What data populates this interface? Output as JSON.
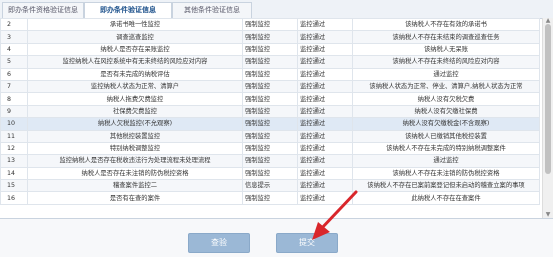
{
  "tabs": [
    {
      "label": "即办条件资格验证信息"
    },
    {
      "label": "即办条件验证信息"
    },
    {
      "label": "其他条件验证信息"
    }
  ],
  "table": {
    "rows": [
      {
        "no": "2",
        "item": "承诺书唯一性监控",
        "type": "强制监控",
        "result": "监控通过",
        "desc": "该纳税人不存在有效的承诺书"
      },
      {
        "no": "3",
        "item": "调查巡查监控",
        "type": "强制监控",
        "result": "监控通过",
        "desc": "该纳税人不存在未结束的调查巡查任务"
      },
      {
        "no": "4",
        "item": "纳税人是否存在呆账监控",
        "type": "强制监控",
        "result": "监控通过",
        "desc": "该纳税人无呆账"
      },
      {
        "no": "5",
        "item": "监控纳税人在风控系统中有无未终结的风险应对内容",
        "type": "强制监控",
        "result": "监控通过",
        "desc": "该纳税人不存在未终结的风险应对内容"
      },
      {
        "no": "6",
        "item": "是否有未完成的纳税评估",
        "type": "强制监控",
        "result": "监控通过",
        "desc": "通过监控"
      },
      {
        "no": "7",
        "item": "监控纳税人状态为正常、清算户",
        "type": "强制监控",
        "result": "监控通过",
        "desc": "该纳税人状态为正常、停业、清算户,纳税人状态为正常"
      },
      {
        "no": "8",
        "item": "纳税人拖费欠费监控",
        "type": "强制监控",
        "result": "监控通过",
        "desc": "纳税人没有欠税欠费"
      },
      {
        "no": "9",
        "item": "社保费欠费监控",
        "type": "强制监控",
        "result": "监控通过",
        "desc": "纳税人没有欠缴社保费"
      },
      {
        "no": "10",
        "item": "纳税人欠税监控(不允观察)",
        "type": "强制监控",
        "result": "监控通过",
        "desc": "纳税人没有欠缴税金(不含观察)"
      },
      {
        "no": "11",
        "item": "其他税控装置监控",
        "type": "强制监控",
        "result": "监控通过",
        "desc": "该纳税人已缴销其他税控装置"
      },
      {
        "no": "12",
        "item": "特别纳税调整监控",
        "type": "强制监控",
        "result": "监控通过",
        "desc": "该纳税人不存在未完成的特别纳税调整案件"
      },
      {
        "no": "13",
        "item": "监控纳税人是否存在税收违法行为处理流程未处理流程",
        "type": "强制监控",
        "result": "监控通过",
        "desc": "通过监控"
      },
      {
        "no": "14",
        "item": "纳税人是否存在未注销的防伪税控资格",
        "type": "强制监控",
        "result": "监控通过",
        "desc": "该纳税人不存在未注销的防伪税控资格"
      },
      {
        "no": "15",
        "item": "稽查案件监控二",
        "type": "信息提示",
        "result": "监控通过",
        "desc": "该纳税人不存在已案前案登记但未启动的稽查立案的事项"
      },
      {
        "no": "16",
        "item": "是否有在查的案件",
        "type": "强制监控",
        "result": "监控通过",
        "desc": "此纳税人不存在在查案件"
      }
    ]
  },
  "buttons": {
    "check": "查验",
    "submit": "提交"
  },
  "colors": {
    "button": "#9bb8d6",
    "tab_active_text": "#1a4f8a",
    "arrow": "#d9262b"
  },
  "icons": {
    "scroll_up": "▲",
    "scroll_down": "▼"
  }
}
